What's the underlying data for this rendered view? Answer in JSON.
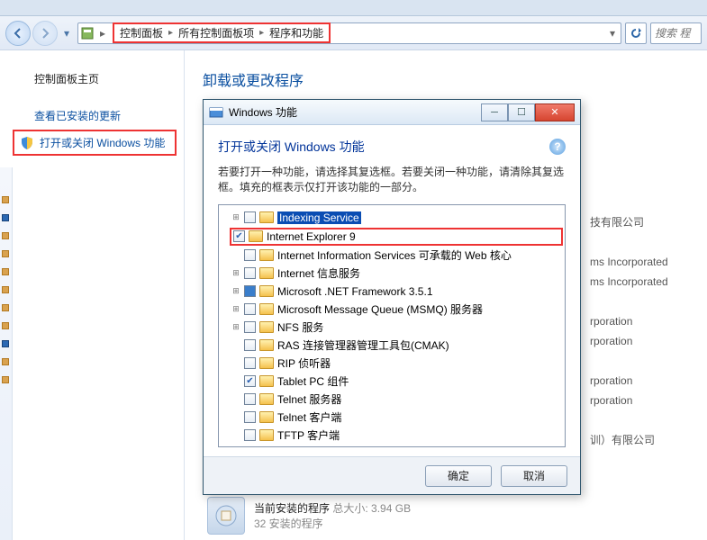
{
  "breadcrumb": {
    "items": [
      "控制面板",
      "所有控制面板项",
      "程序和功能"
    ]
  },
  "search": {
    "placeholder": "搜索 程"
  },
  "sidebar": {
    "header": "控制面板主页",
    "links": {
      "updates": "查看已安装的更新",
      "features": "打开或关闭 Windows 功能"
    }
  },
  "main": {
    "title": "卸载或更改程序"
  },
  "right_list": [
    "技有限公司",
    "",
    "ms Incorporated",
    "ms Incorporated",
    "",
    "rporation",
    "rporation",
    "",
    "rporation",
    "rporation",
    "",
    "训）有限公司"
  ],
  "status": {
    "line1_left": "当前安装的程序",
    "line1_mid": "总大小:",
    "line1_right": "3.94 GB",
    "line2": "32 安装的程序"
  },
  "dialog": {
    "title": "Windows 功能",
    "heading": "打开或关闭 Windows 功能",
    "desc": "若要打开一种功能，请选择其复选框。若要关闭一种功能，请清除其复选框。填充的框表示仅打开该功能的一部分。",
    "items": [
      {
        "label": "Indexing Service",
        "checked": false,
        "expander": true,
        "highlight": true
      },
      {
        "label": "Internet Explorer 9",
        "checked": true,
        "expander": false,
        "redbox": true
      },
      {
        "label": "Internet Information Services 可承载的 Web 核心",
        "checked": false,
        "expander": false
      },
      {
        "label": "Internet 信息服务",
        "checked": false,
        "expander": true
      },
      {
        "label": "Microsoft .NET Framework 3.5.1",
        "checked": "filled",
        "expander": true
      },
      {
        "label": "Microsoft Message Queue (MSMQ) 服务器",
        "checked": false,
        "expander": true
      },
      {
        "label": "NFS 服务",
        "checked": false,
        "expander": true
      },
      {
        "label": "RAS 连接管理器管理工具包(CMAK)",
        "checked": false,
        "expander": false
      },
      {
        "label": "RIP 侦听器",
        "checked": false,
        "expander": false
      },
      {
        "label": "Tablet PC 组件",
        "checked": true,
        "expander": false
      },
      {
        "label": "Telnet 服务器",
        "checked": false,
        "expander": false
      },
      {
        "label": "Telnet 客户端",
        "checked": false,
        "expander": false
      },
      {
        "label": "TFTP 客户端",
        "checked": false,
        "expander": false
      }
    ],
    "ok": "确定",
    "cancel": "取消"
  }
}
